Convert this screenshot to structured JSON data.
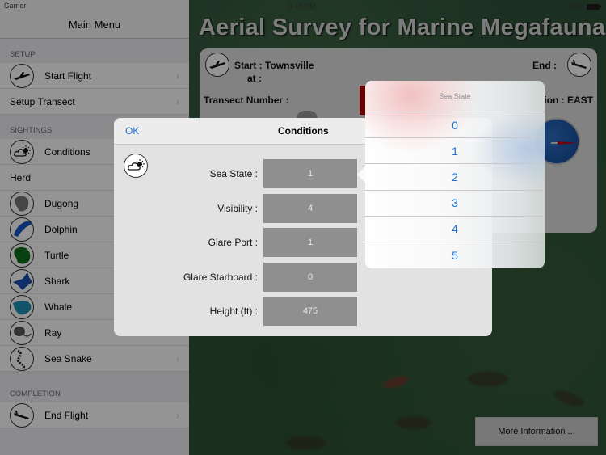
{
  "status_bar": {
    "carrier": "Carrier",
    "time": "3:48 PM",
    "battery": "100%"
  },
  "sidebar": {
    "title": "Main Menu",
    "sections": [
      {
        "header": "SETUP",
        "items": [
          {
            "label": "Start Flight",
            "icon": "airplane-takeoff-icon"
          },
          {
            "label": "Setup Transect",
            "icon": ""
          }
        ]
      },
      {
        "header": "SIGHTINGS",
        "items": [
          {
            "label": "Conditions",
            "icon": "weather-icon"
          },
          {
            "label": "Herd",
            "icon": ""
          },
          {
            "label": "Dugong",
            "icon": "dugong-icon"
          },
          {
            "label": "Dolphin",
            "icon": "dolphin-icon"
          },
          {
            "label": "Turtle",
            "icon": "turtle-icon"
          },
          {
            "label": "Shark",
            "icon": "shark-icon"
          },
          {
            "label": "Whale",
            "icon": "whale-icon"
          },
          {
            "label": "Ray",
            "icon": "ray-icon"
          },
          {
            "label": "Sea Snake",
            "icon": "sea-snake-icon"
          }
        ]
      },
      {
        "header": "COMPLETION",
        "items": [
          {
            "label": "End Flight",
            "icon": "airplane-landing-icon"
          }
        ]
      }
    ]
  },
  "main": {
    "title": "Aerial Survey for Marine Megafauna",
    "start_label": "Start : Townsville",
    "at_label": "at :",
    "end_label": "End :",
    "transect_label": "Transect Number :",
    "direction_label": "ion : EAST",
    "more_info": "More Information ..."
  },
  "conditions": {
    "ok": "OK",
    "title": "Conditions",
    "fields": [
      {
        "label": "Sea State :",
        "value": "1"
      },
      {
        "label": "Visibility :",
        "value": "4"
      },
      {
        "label": "Glare Port :",
        "value": "1"
      },
      {
        "label": "Glare Starboard :",
        "value": "0"
      },
      {
        "label": "Height (ft) :",
        "value": "475"
      }
    ]
  },
  "picker": {
    "title": "Sea State",
    "options": [
      "0",
      "1",
      "2",
      "3",
      "4",
      "5"
    ]
  },
  "colors": {
    "accent": "#1a73d6",
    "transect_bar": "#b00000",
    "compass": "#1a5bb0"
  }
}
